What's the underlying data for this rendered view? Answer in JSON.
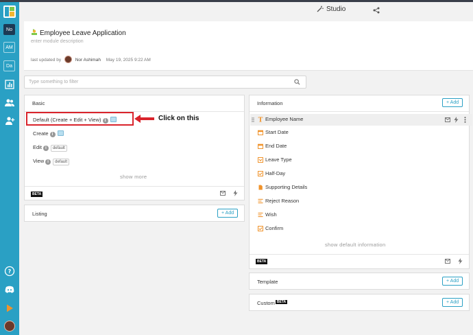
{
  "sidebar": {
    "tiles": [
      "No",
      "AM",
      "Da"
    ]
  },
  "header": {
    "studio_label": "Studio"
  },
  "module": {
    "title": "Employee Leave Application",
    "description_placeholder": "enter module description",
    "last_updated_label": "last updated by",
    "updated_by": "Nor Ashimah",
    "updated_at": "May 19, 2025 9:22 AM"
  },
  "filter": {
    "placeholder": "Type something to filter"
  },
  "basic": {
    "title": "Basic",
    "rows": {
      "default": "Default (Create + Edit + View)",
      "create": "Create",
      "edit": "Edit",
      "view": "View"
    },
    "edit_tag": "default",
    "view_tag": "default",
    "show_more": "show more",
    "beta": "BETA"
  },
  "listing": {
    "title": "Listing",
    "add_label": "+ Add"
  },
  "annotation": {
    "text": "Click on this"
  },
  "information": {
    "title": "Information",
    "add_label": "+ Add",
    "fields": [
      "Employee Name",
      "Start Date",
      "End Date",
      "Leave Type",
      "Half-Day",
      "Supporting Details",
      "Reject Reason",
      "Wish",
      "Confirm"
    ],
    "show_default": "show default information",
    "beta": "BETA"
  },
  "template": {
    "title": "Template",
    "add_label": "+ Add"
  },
  "custom": {
    "title": "Custom",
    "beta": "BETA",
    "add_label": "+ Add"
  },
  "colors": {
    "sidebar": "#2aa0c4",
    "accent": "#2aa0c4",
    "highlight": "#d9232b",
    "field_icon": "#f0932b"
  }
}
